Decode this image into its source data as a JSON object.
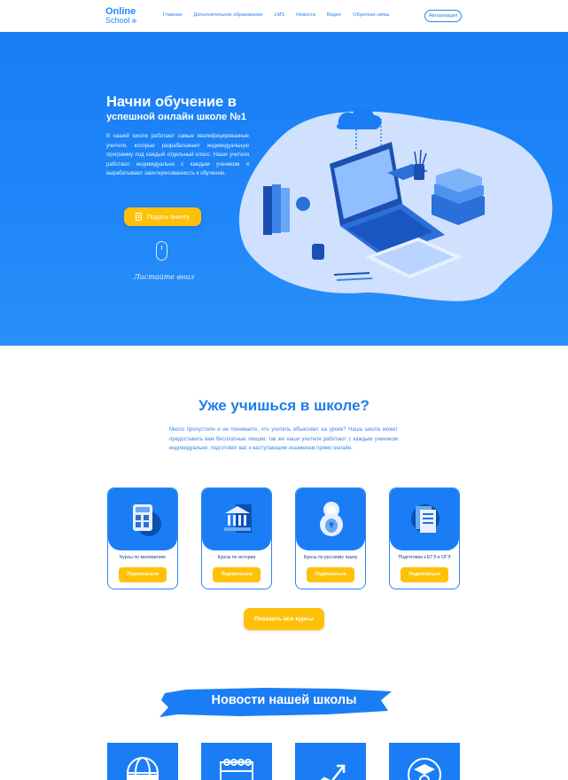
{
  "header": {
    "logo_line1": "Online",
    "logo_line2": "School",
    "logo_icon": "globe-icon",
    "nav": [
      "Главная",
      "Дополнительное образование",
      "LMS",
      "Новости",
      "Видео",
      "Обратная связь"
    ],
    "auth_button": "Авторизация"
  },
  "hero": {
    "title_line1": "Начни обучение в",
    "title_line2": "успешной онлайн школе №1",
    "text": "В нашей школе работают самые квалифицированные учителя, которые разрабатывают индивидуальную программу под каждый отдельный класс. Наши учителя работают индивидуально с каждым учеником и вырабатывают заинтересованность к обучению.",
    "cta": "Подать анкету",
    "cta_icon": "document-icon",
    "scroll_icon": "mouse-icon",
    "scroll_text": "Листайте вниз"
  },
  "courses": {
    "title": "Уже учишься в школе?",
    "text": "Много пропустили и не понимаете, что учитель объясняет на уроке? Наша школа может предоставить вам бесплатные лекции, так же наши учителя работают с каждым учеником индивидуально, подготовят вас к наступающим экзаменам прямо онлайн.",
    "cards": [
      {
        "label": "Курсы по математике",
        "button": "Подписаться",
        "icon": "calculator-icon"
      },
      {
        "label": "Курсы по истории",
        "button": "Подписаться",
        "icon": "museum-icon"
      },
      {
        "label": "Курсы по русскому языку",
        "button": "Подписаться",
        "icon": "matryoshka-icon"
      },
      {
        "label": "Подготовка к ЕГЭ и ОГЭ",
        "button": "Подписаться",
        "icon": "exam-papers-icon"
      }
    ],
    "all_button": "Показать все курсы"
  },
  "news": {
    "title": "Новости нашей школы",
    "icons": [
      "news-globe-icon",
      "calendar-icon",
      "growth-chart-icon",
      "graduate-icon"
    ]
  },
  "colors": {
    "primary": "#1a7df5",
    "accent": "#ffc107",
    "text": "#2f7fe6"
  }
}
